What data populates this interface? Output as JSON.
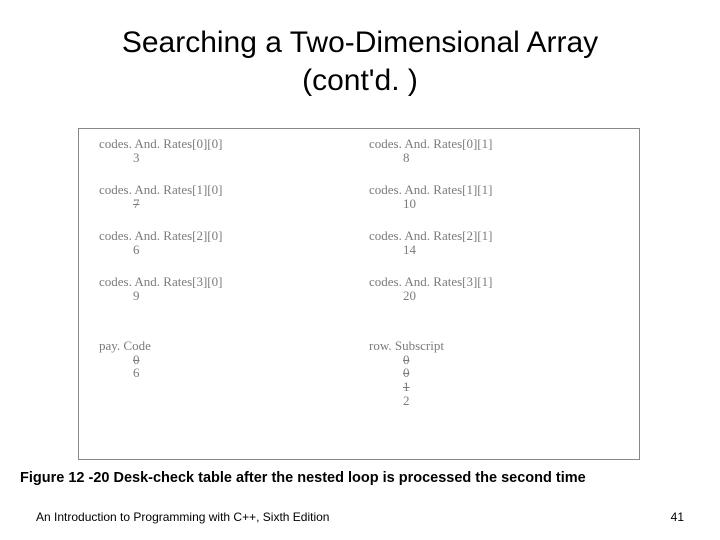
{
  "title_line1": "Searching a Two-Dimensional Array",
  "title_line2": "(cont'd. )",
  "cells": {
    "r0c0": {
      "label": "codes. And. Rates[0][0]",
      "value": "3"
    },
    "r0c1": {
      "label": "codes. And. Rates[0][1]",
      "value": "8"
    },
    "r1c0": {
      "label": "codes. And. Rates[1][0]",
      "value": "7"
    },
    "r1c1": {
      "label": "codes. And. Rates[1][1]",
      "value": "10"
    },
    "r2c0": {
      "label": "codes. And. Rates[2][0]",
      "value": "6"
    },
    "r2c1": {
      "label": "codes. And. Rates[2][1]",
      "value": "14"
    },
    "r3c0": {
      "label": "codes. And. Rates[3][0]",
      "value": "9"
    },
    "r3c1": {
      "label": "codes. And. Rates[3][1]",
      "value": "20"
    }
  },
  "paycode": {
    "label": "pay. Code",
    "struck": "0",
    "value": "6"
  },
  "rowsub": {
    "label": "row. Subscript",
    "struck1": "0",
    "struck2": "0",
    "struck3": "1",
    "value": "2"
  },
  "caption": "Figure 12 -20 Desk-check table after the nested loop is processed the second time",
  "footer_left": "An Introduction to Programming with C++, Sixth Edition",
  "footer_right": "41"
}
